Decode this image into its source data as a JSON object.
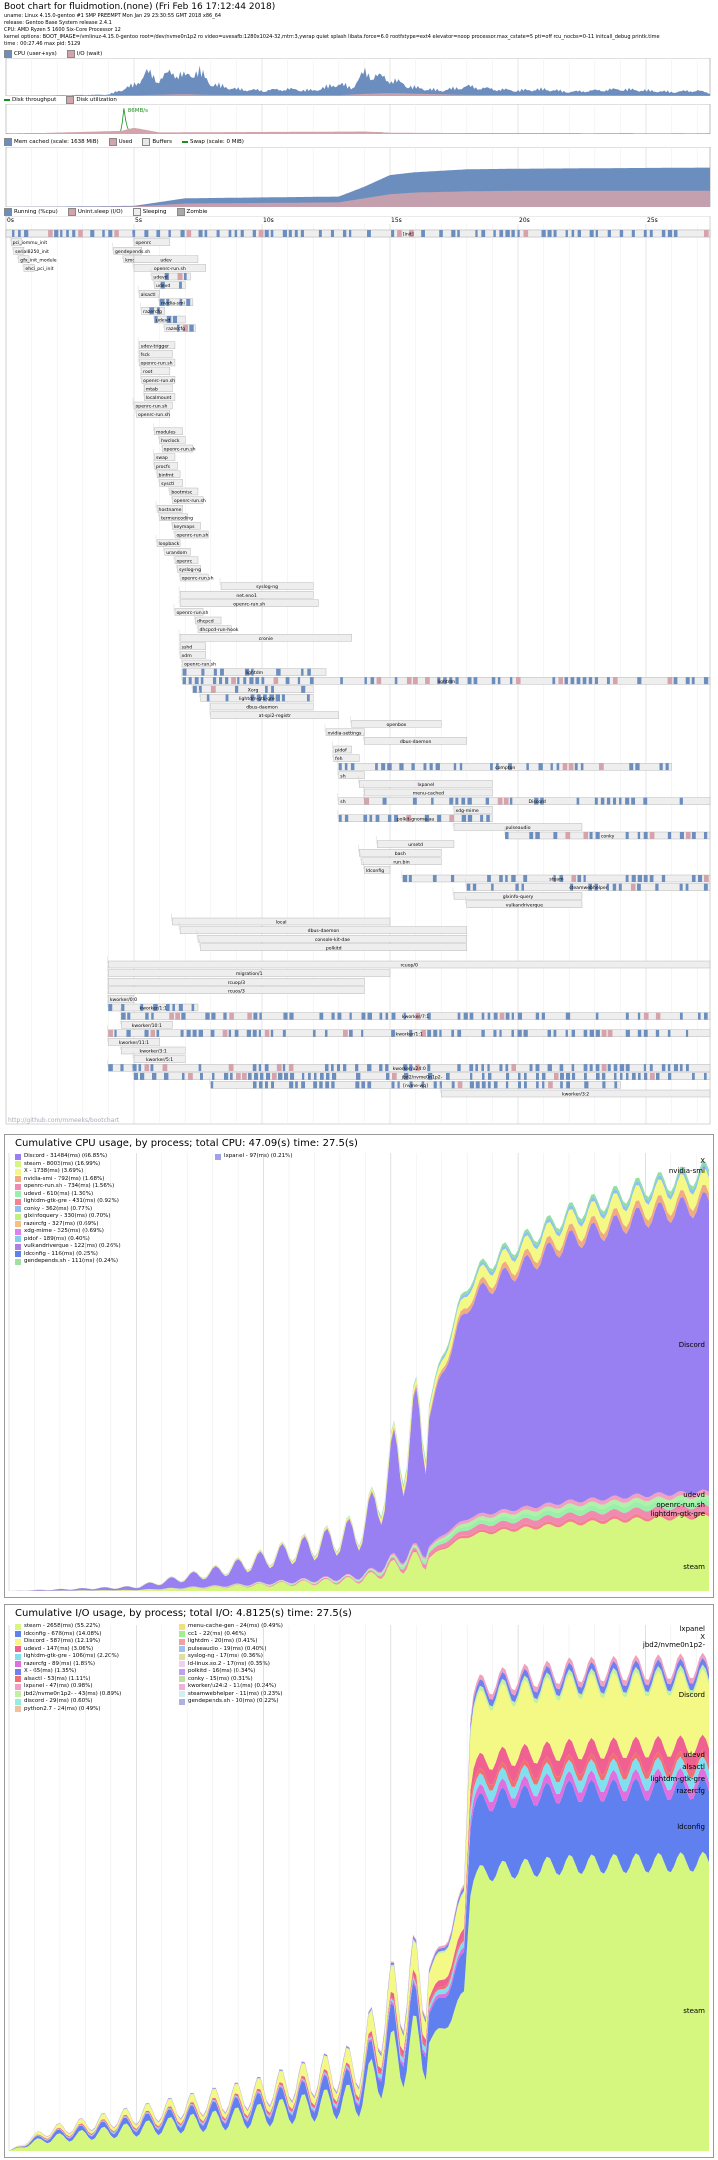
{
  "header": {
    "title": "Boot chart for fluidmotion.(none) (Fri Feb 16 17:12:44 2018)",
    "lines": [
      "uname: Linux 4.15.0-gentoo #1 SMP PREEMPT Mon Jan 29 23:30:55 GMT 2018 x86_64",
      "release: Gentoo Base System release 2.4.1",
      "CPU: AMD Ryzen 5 1600 Six-Core Processor 12",
      "kernel options: BOOT_IMAGE=/vmlinuz-4.15.0-gentoo root=/dev/nvme0n1p2 ro video=uvesafb:1280x1024-32,mtrr:3,ywrap quiet splash libata.force=6.0 rootfstype=ext4 elevator=noop processor.max_cstate=5 pti=off rcu_nocbs=0-11 initcall_debug printk.time",
      "time : 00:27.46     max pid: 5129"
    ]
  },
  "legends": {
    "cpu": [
      {
        "label": "CPU (user+sys)",
        "color": "#6b8ebf"
      },
      {
        "label": "I/O (wait)",
        "color": "#d4a3ab"
      }
    ],
    "disk": [
      {
        "label": "Disk throughput",
        "color": "#1e8f1e"
      },
      {
        "label": "Disk utilization",
        "color": "#d4a3ab"
      }
    ],
    "disk_peak": "86MB/s",
    "mem": [
      {
        "label": "Mem cached (scale: 1638 MiB)",
        "color": "#6b8ebf"
      },
      {
        "label": "Used",
        "color": "#d4a3ab"
      },
      {
        "label": "Buffers",
        "color": "#e8e8e8"
      },
      {
        "label": "Swap (scale: 0 MiB)",
        "color": "#1e8f1e"
      }
    ],
    "proc": [
      {
        "label": "Running (%cpu)",
        "color": "#6b8ebf"
      },
      {
        "label": "Unint.sleep (I/O)",
        "color": "#d4a3ab"
      },
      {
        "label": "Sleeping",
        "color": "#eeeeee"
      },
      {
        "label": "Zombie",
        "color": "#aaaaaa"
      }
    ]
  },
  "time_axis": [
    "0s",
    "5s",
    "10s",
    "15s",
    "20s",
    "25s"
  ],
  "processes": [
    {
      "name": "init",
      "start": 0.0,
      "end": 27.5,
      "depth": 0
    },
    {
      "name": "k-boot",
      "start": 0.0,
      "end": 4.0,
      "depth": 0
    },
    {
      "name": "pci_iommu_init",
      "start": 0.2,
      "end": 0.6,
      "depth": 1
    },
    {
      "name": "serial8250_init",
      "start": 0.3,
      "end": 0.7,
      "depth": 2
    },
    {
      "name": "gfx_init_module",
      "start": 0.5,
      "end": 0.9,
      "depth": 3
    },
    {
      "name": "ehci_pci_init",
      "start": 0.7,
      "end": 1.1,
      "depth": 4
    },
    {
      "name": "[init]",
      "start": 0.0,
      "end": 27.5,
      "depth": 0
    },
    {
      "name": "openrc",
      "start": 5.0,
      "end": 6.4,
      "depth": 1
    },
    {
      "name": "gendepends.sh",
      "start": 4.2,
      "end": 5.3,
      "depth": 2
    },
    {
      "name": "kmod-static-nodes",
      "start": 4.6,
      "end": 5.6,
      "depth": 3
    },
    {
      "name": "udev",
      "start": 5.0,
      "end": 7.5,
      "depth": 3
    },
    {
      "name": "openrc-run.sh",
      "start": 5.0,
      "end": 7.8,
      "depth": 4
    },
    {
      "name": "udevd",
      "start": 5.7,
      "end": 7.2,
      "depth": 5
    },
    {
      "name": "udevd",
      "start": 5.8,
      "end": 7.0,
      "depth": 6
    },
    {
      "name": "alsactl",
      "start": 5.2,
      "end": 6.0,
      "depth": 7
    },
    {
      "name": "nvidia-smi",
      "start": 6.0,
      "end": 7.3,
      "depth": 8
    },
    {
      "name": "razercfg",
      "start": 5.3,
      "end": 6.2,
      "depth": 9
    },
    {
      "name": "udevd",
      "start": 5.8,
      "end": 7.0,
      "depth": 10
    },
    {
      "name": "razercfg",
      "start": 6.2,
      "end": 7.4,
      "depth": 11
    },
    {
      "name": "udev-trigger",
      "start": 5.2,
      "end": 6.6,
      "depth": 13
    },
    {
      "name": "fsck",
      "start": 5.2,
      "end": 6.5,
      "depth": 14
    },
    {
      "name": "openrc-run.sh",
      "start": 5.2,
      "end": 6.6,
      "depth": 15
    },
    {
      "name": "root",
      "start": 5.3,
      "end": 6.4,
      "depth": 16
    },
    {
      "name": "openrc-run.sh",
      "start": 5.3,
      "end": 6.6,
      "depth": 17
    },
    {
      "name": "mtab",
      "start": 5.4,
      "end": 6.5,
      "depth": 18
    },
    {
      "name": "localmount",
      "start": 5.4,
      "end": 6.6,
      "depth": 19
    },
    {
      "name": "openrc-run.sh",
      "start": 5.0,
      "end": 6.5,
      "depth": 20
    },
    {
      "name": "openrc-run.sh",
      "start": 5.1,
      "end": 6.4,
      "depth": 21
    },
    {
      "name": "modules",
      "start": 5.8,
      "end": 6.9,
      "depth": 23
    },
    {
      "name": "hwclock",
      "start": 6.0,
      "end": 7.0,
      "depth": 24
    },
    {
      "name": "openrc-run.sh",
      "start": 6.1,
      "end": 7.3,
      "depth": 25
    },
    {
      "name": "swap",
      "start": 5.8,
      "end": 6.6,
      "depth": 26
    },
    {
      "name": "procfs",
      "start": 5.8,
      "end": 6.7,
      "depth": 27
    },
    {
      "name": "binfmt",
      "start": 5.9,
      "end": 6.8,
      "depth": 28
    },
    {
      "name": "sysctl",
      "start": 6.0,
      "end": 6.9,
      "depth": 29
    },
    {
      "name": "bootmisc",
      "start": 6.4,
      "end": 7.5,
      "depth": 30
    },
    {
      "name": "openrc-run.sh",
      "start": 6.5,
      "end": 7.7,
      "depth": 31
    },
    {
      "name": "hostname",
      "start": 5.9,
      "end": 6.9,
      "depth": 32
    },
    {
      "name": "termencoding",
      "start": 6.0,
      "end": 7.1,
      "depth": 33
    },
    {
      "name": "keymaps",
      "start": 6.5,
      "end": 7.6,
      "depth": 34
    },
    {
      "name": "openrc-run.sh",
      "start": 6.6,
      "end": 7.9,
      "depth": 35
    },
    {
      "name": "loopback",
      "start": 5.9,
      "end": 6.8,
      "depth": 36
    },
    {
      "name": "urandom",
      "start": 6.2,
      "end": 7.2,
      "depth": 37
    },
    {
      "name": "openrc",
      "start": 6.6,
      "end": 7.5,
      "depth": 38
    },
    {
      "name": "syslog-ng",
      "start": 6.7,
      "end": 7.6,
      "depth": 39
    },
    {
      "name": "openrc-run.sh",
      "start": 6.8,
      "end": 7.9,
      "depth": 40
    },
    {
      "name": "syslog-ng",
      "start": 8.4,
      "end": 12.0,
      "depth": 41
    },
    {
      "name": "net.eno1",
      "start": 6.8,
      "end": 12.0,
      "depth": 42
    },
    {
      "name": "openrc-run.sh",
      "start": 6.8,
      "end": 12.2,
      "depth": 43
    },
    {
      "name": "openrc-run.sh",
      "start": 6.6,
      "end": 7.7,
      "depth": 44
    },
    {
      "name": "dhcpcd",
      "start": 7.4,
      "end": 8.4,
      "depth": 45
    },
    {
      "name": "dhcpcd-run-hook",
      "start": 7.5,
      "end": 8.8,
      "depth": 46
    },
    {
      "name": "cronie",
      "start": 6.8,
      "end": 13.5,
      "depth": 47
    },
    {
      "name": "sshd",
      "start": 6.8,
      "end": 7.8,
      "depth": 48
    },
    {
      "name": "xdm",
      "start": 6.8,
      "end": 7.8,
      "depth": 49
    },
    {
      "name": "openrc-run.sh",
      "start": 6.9,
      "end": 8.0,
      "depth": 50
    },
    {
      "name": "lightdm",
      "start": 6.9,
      "end": 12.5,
      "depth": 51
    },
    {
      "name": "lightdm",
      "start": 6.9,
      "end": 27.5,
      "depth": 52
    },
    {
      "name": "Xorg",
      "start": 7.3,
      "end": 12.0,
      "depth": 53
    },
    {
      "name": "lightdm-gtk-gre",
      "start": 7.6,
      "end": 12.0,
      "depth": 54
    },
    {
      "name": "dbus-daemon",
      "start": 8.0,
      "end": 12.0,
      "depth": 55
    },
    {
      "name": "at-spi2-registr",
      "start": 8.0,
      "end": 13.0,
      "depth": 56
    },
    {
      "name": "openbox",
      "start": 13.5,
      "end": 17.0,
      "depth": 57
    },
    {
      "name": "nvidia-settings",
      "start": 12.5,
      "end": 14.0,
      "depth": 58
    },
    {
      "name": "dbus-daemon",
      "start": 14.0,
      "end": 18.0,
      "depth": 59
    },
    {
      "name": "pidof",
      "start": 12.8,
      "end": 13.5,
      "depth": 60
    },
    {
      "name": "feh",
      "start": 12.8,
      "end": 13.8,
      "depth": 61
    },
    {
      "name": "compton",
      "start": 13.0,
      "end": 26.0,
      "depth": 62
    },
    {
      "name": "sh",
      "start": 13.0,
      "end": 14.0,
      "depth": 63
    },
    {
      "name": "lxpanel",
      "start": 13.8,
      "end": 19.0,
      "depth": 64
    },
    {
      "name": "menu-cached",
      "start": 14.0,
      "end": 19.0,
      "depth": 65
    },
    {
      "name": "sh",
      "start": 13.0,
      "end": 14.0,
      "depth": 66
    },
    {
      "name": "Discord",
      "start": 14.0,
      "end": 27.5,
      "depth": 66
    },
    {
      "name": "xdg-mime",
      "start": 17.5,
      "end": 19.0,
      "depth": 67
    },
    {
      "name": "polkit-gnome-au",
      "start": 13.0,
      "end": 19.0,
      "depth": 68
    },
    {
      "name": "pulseaudio",
      "start": 17.5,
      "end": 22.5,
      "depth": 69
    },
    {
      "name": "conky",
      "start": 19.5,
      "end": 27.5,
      "depth": 70
    },
    {
      "name": "ursetd",
      "start": 14.5,
      "end": 17.5,
      "depth": 71
    },
    {
      "name": "bash",
      "start": 13.8,
      "end": 17.0,
      "depth": 72
    },
    {
      "name": "run.bin",
      "start": 13.9,
      "end": 17.0,
      "depth": 73
    },
    {
      "name": "ldconfig",
      "start": 14.0,
      "end": 15.0,
      "depth": 74
    },
    {
      "name": "steam",
      "start": 15.5,
      "end": 27.5,
      "depth": 75
    },
    {
      "name": "steamwebhelper",
      "start": 18.0,
      "end": 27.5,
      "depth": 76
    },
    {
      "name": "glxinfo-query",
      "start": 17.5,
      "end": 22.5,
      "depth": 77
    },
    {
      "name": "vulkandriverque",
      "start": 18.0,
      "end": 22.5,
      "depth": 78
    },
    {
      "name": "local",
      "start": 6.5,
      "end": 15.0,
      "depth": 80
    },
    {
      "name": "dbus-daemon",
      "start": 6.8,
      "end": 18.0,
      "depth": 81
    },
    {
      "name": "console-kit-dae",
      "start": 7.5,
      "end": 18.0,
      "depth": 82
    },
    {
      "name": "polkitd",
      "start": 7.6,
      "end": 18.0,
      "depth": 83
    },
    {
      "name": "rcuop/0",
      "start": 4.0,
      "end": 27.5,
      "depth": 85
    },
    {
      "name": "migration/1",
      "start": 4.0,
      "end": 15.0,
      "depth": 86
    },
    {
      "name": "rcuop/3",
      "start": 4.0,
      "end": 14.0,
      "depth": 87
    },
    {
      "name": "rcuos/3",
      "start": 4.0,
      "end": 14.0,
      "depth": 88
    },
    {
      "name": "kworker/0:0",
      "start": 4.0,
      "end": 5.0,
      "depth": 89
    },
    {
      "name": "kworker/1:1",
      "start": 4.0,
      "end": 7.5,
      "depth": 90
    },
    {
      "name": "kworker/7:1",
      "start": 4.5,
      "end": 27.5,
      "depth": 91
    },
    {
      "name": "kworker/10:1",
      "start": 4.5,
      "end": 6.5,
      "depth": 92
    },
    {
      "name": "kworker/1:1",
      "start": 4.0,
      "end": 27.5,
      "depth": 93
    },
    {
      "name": "kworker/11:1",
      "start": 4.0,
      "end": 6.0,
      "depth": 94
    },
    {
      "name": "kworker/3:1",
      "start": 4.5,
      "end": 7.0,
      "depth": 95
    },
    {
      "name": "kworker/5:1",
      "start": 5.0,
      "end": 7.0,
      "depth": 96
    },
    {
      "name": "kworker/u24:0",
      "start": 4.0,
      "end": 27.5,
      "depth": 97
    },
    {
      "name": "jbd2/nvme0n1p2-",
      "start": 5.0,
      "end": 27.5,
      "depth": 98
    },
    {
      "name": "[nvme-wq]",
      "start": 8.0,
      "end": 24.0,
      "depth": 99
    },
    {
      "name": "kworker/3:2",
      "start": 17.0,
      "end": 27.5,
      "depth": 100
    }
  ],
  "watermark": "http://github.com/mmeeks/bootchart",
  "cpu_panel": {
    "title": "Cumulative CPU usage, by process; total CPU:  47.09(s) time: 27.5(s)",
    "legend": [
      {
        "label": "Discord - 31484(ms) (66.85%)",
        "color": "#9980f2"
      },
      {
        "label": "steam - 8003(ms) (16.99%)",
        "color": "#d5f780"
      },
      {
        "label": "X - 1738(ms) (3.69%)",
        "color": "#f4f884"
      },
      {
        "label": "nvidia-smi - 792(ms) (1.68%)",
        "color": "#f0ab84"
      },
      {
        "label": "openrc-run.sh - 734(ms) (1.56%)",
        "color": "#f08ab0"
      },
      {
        "label": "udevd - 610(ms) (1.30%)",
        "color": "#9af0a8"
      },
      {
        "label": "lightdm-gtk-gre - 431(ms) (0.92%)",
        "color": "#f48090"
      },
      {
        "label": "conky - 362(ms) (0.77%)",
        "color": "#8ec0f0"
      },
      {
        "label": "glxinfoquery - 330(ms) (0.70%)",
        "color": "#c0f080"
      },
      {
        "label": "razercfg - 327(ms) (0.69%)",
        "color": "#f6c080"
      },
      {
        "label": "xdg-mime - 325(ms) (0.69%)",
        "color": "#e080f0"
      },
      {
        "label": "pidof - 189(ms) (0.40%)",
        "color": "#80d0f0"
      },
      {
        "label": "vulkandriverque - 122(ms) (0.26%)",
        "color": "#b080e0"
      },
      {
        "label": "ldconfig - 116(ms) (0.25%)",
        "color": "#6080f0"
      },
      {
        "label": "gendepends.sh - 111(ms) (0.24%)",
        "color": "#a0e0a0"
      },
      {
        "label": "lxpanel - 97(ms) (0.21%)",
        "color": "#a0a0f0"
      }
    ],
    "band_labels": [
      "X",
      "nvidia-smi",
      "Discord",
      "udevd",
      "openrc-run.sh",
      "lightdm-gtk-gre",
      "steam"
    ]
  },
  "io_panel": {
    "title": "Cumulative I/O usage, by process; total I/O:  4.8125(s) time: 27.5(s)",
    "legend": [
      {
        "label": "steam - 2658(ms) (55.22%)",
        "color": "#d5f780"
      },
      {
        "label": "ldconfig - 678(ms) (14.08%)",
        "color": "#6080f0"
      },
      {
        "label": "Discord - 587(ms) (12.19%)",
        "color": "#f4f884"
      },
      {
        "label": "udevd - 147(ms) (3.06%)",
        "color": "#f06090"
      },
      {
        "label": "lightdm-gtk-gre - 106(ms) (2.20%)",
        "color": "#80e0f0"
      },
      {
        "label": "razercfg - 89(ms) (1.85%)",
        "color": "#e070e0"
      },
      {
        "label": "X - 65(ms) (1.35%)",
        "color": "#7080f0"
      },
      {
        "label": "alsactl - 53(ms) (1.11%)",
        "color": "#f07070"
      },
      {
        "label": "lxpanel - 47(ms) (0.98%)",
        "color": "#f0a0c0"
      },
      {
        "label": "jbd2/nvme0n1p2- - 43(ms) (0.89%)",
        "color": "#c0f0a0"
      },
      {
        "label": "discord - 29(ms) (0.60%)",
        "color": "#90f0e0"
      },
      {
        "label": "python2.7 - 24(ms) (0.49%)",
        "color": "#f0c0a0"
      },
      {
        "label": "menu-cache-gen - 24(ms) (0.49%)",
        "color": "#f0e080"
      },
      {
        "label": "cc1 - 22(ms) (0.46%)",
        "color": "#a0f090"
      },
      {
        "label": "lightdm - 20(ms) (0.41%)",
        "color": "#f0a0a0"
      },
      {
        "label": "pulseaudio - 19(ms) (0.40%)",
        "color": "#a0c0f0"
      },
      {
        "label": "syslog-ng - 17(ms) (0.36%)",
        "color": "#e0e0a0"
      },
      {
        "label": "ld-linux.so.2 - 17(ms) (0.35%)",
        "color": "#f0d0f0"
      },
      {
        "label": "polkitd - 16(ms) (0.34%)",
        "color": "#c0a0f0"
      },
      {
        "label": "conky - 15(ms) (0.31%)",
        "color": "#c0e0a0"
      },
      {
        "label": "kworker/u24:2 - 11(ms) (0.24%)",
        "color": "#f0b0e0"
      },
      {
        "label": "steamwebhelper - 11(ms) (0.23%)",
        "color": "#d0f0f0"
      },
      {
        "label": "gendepends.sh - 10(ms) (0.22%)",
        "color": "#b0b0e0"
      }
    ],
    "band_labels": [
      "lxpanel",
      "X",
      "jbd2/nvme0n1p2-",
      "Discord",
      "udevd",
      "alsactl",
      "lightdm-gtk-gre",
      "razercfg",
      "ldconfig",
      "steam"
    ]
  },
  "chart_data": [
    {
      "type": "area",
      "name_hint": "cpu-io",
      "x_range": [
        0,
        27.5
      ],
      "series": [
        {
          "name": "CPU (user+sys)",
          "x": [
            0,
            4,
            5,
            5.5,
            6,
            6.5,
            7,
            7.5,
            8,
            9,
            10,
            11,
            12,
            13,
            13.5,
            14,
            15,
            16,
            17,
            18,
            19,
            20,
            21,
            22,
            23,
            24,
            25,
            26,
            27,
            27.5
          ],
          "values": [
            0,
            5,
            40,
            85,
            60,
            90,
            70,
            95,
            45,
            25,
            20,
            25,
            20,
            45,
            30,
            85,
            60,
            30,
            20,
            35,
            25,
            20,
            25,
            15,
            20,
            25,
            20,
            15,
            20,
            10
          ]
        },
        {
          "name": "I/O (wait)",
          "x": [
            0,
            5,
            7,
            8,
            13,
            14,
            15,
            18,
            27.5
          ],
          "values": [
            0,
            2,
            5,
            3,
            2,
            6,
            8,
            3,
            1
          ]
        }
      ]
    },
    {
      "type": "area",
      "name_hint": "disk",
      "x_range": [
        0,
        27.5
      ],
      "series": [
        {
          "name": "Disk throughput",
          "x": [
            0,
            4.5,
            4.6,
            4.7,
            4.8,
            5,
            6,
            7,
            14,
            14.5,
            15,
            27.5
          ],
          "values": [
            0,
            5,
            86,
            30,
            10,
            4,
            3,
            2,
            3,
            5,
            2,
            0
          ]
        },
        {
          "name": "Disk utilization",
          "x": [
            0,
            4.5,
            5,
            6,
            14,
            15,
            27.5
          ],
          "values": [
            0,
            10,
            20,
            5,
            8,
            4,
            0
          ]
        }
      ]
    },
    {
      "type": "area",
      "name_hint": "mem",
      "x_range": [
        0,
        27.5
      ],
      "series": [
        {
          "name": "Mem cached",
          "x": [
            0,
            5,
            7,
            13,
            14,
            15,
            16,
            18,
            20,
            27.5
          ],
          "values": [
            0,
            0.02,
            0.15,
            0.18,
            0.35,
            0.55,
            0.6,
            0.65,
            0.66,
            0.68
          ]
        },
        {
          "name": "Used",
          "x": [
            0,
            5,
            7,
            13,
            14,
            15,
            16,
            18,
            20,
            27.5
          ],
          "values": [
            0,
            0.01,
            0.06,
            0.08,
            0.15,
            0.22,
            0.25,
            0.27,
            0.28,
            0.28
          ]
        }
      ]
    }
  ]
}
